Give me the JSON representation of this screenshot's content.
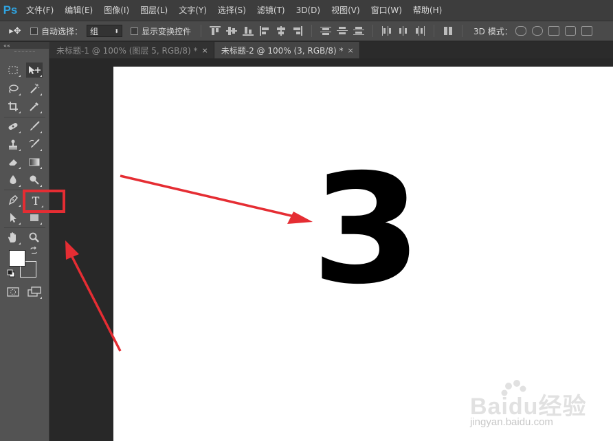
{
  "app": {
    "logo": "Ps"
  },
  "menu": [
    "文件(F)",
    "编辑(E)",
    "图像(I)",
    "图层(L)",
    "文字(Y)",
    "选择(S)",
    "滤镜(T)",
    "3D(D)",
    "视图(V)",
    "窗口(W)",
    "帮助(H)"
  ],
  "options": {
    "auto_select_label": "自动选择：",
    "auto_select_value": "组",
    "show_transform_label": "显示变换控件",
    "mode_3d_label": "3D 模式："
  },
  "tabs": [
    {
      "label": "未标题-1 @ 100% (图层 5, RGB/8) *",
      "close": "×",
      "active": false
    },
    {
      "label": "未标题-2 @ 100% (3, RGB/8) *",
      "close": "×",
      "active": true
    }
  ],
  "canvas": {
    "text": "3"
  },
  "annotation": {
    "arrow_color": "#e52d33",
    "box_color": "#e52d33"
  },
  "colors": {
    "foreground": "#ffffff",
    "background": "#535353"
  },
  "watermark": {
    "brand": "Baidu经验",
    "url": "jingyan.baidu.com"
  },
  "tools": [
    "rectangular-marquee-icon",
    "move-icon",
    "lasso-icon",
    "magic-wand-icon",
    "crop-icon",
    "eyedropper-icon",
    "spot-healing-icon",
    "brush-icon",
    "clone-stamp-icon",
    "history-brush-icon",
    "eraser-icon",
    "gradient-icon",
    "blur-icon",
    "dodge-icon",
    "pen-icon",
    "type-icon",
    "path-selection-icon",
    "rectangle-icon",
    "hand-icon",
    "zoom-icon"
  ]
}
